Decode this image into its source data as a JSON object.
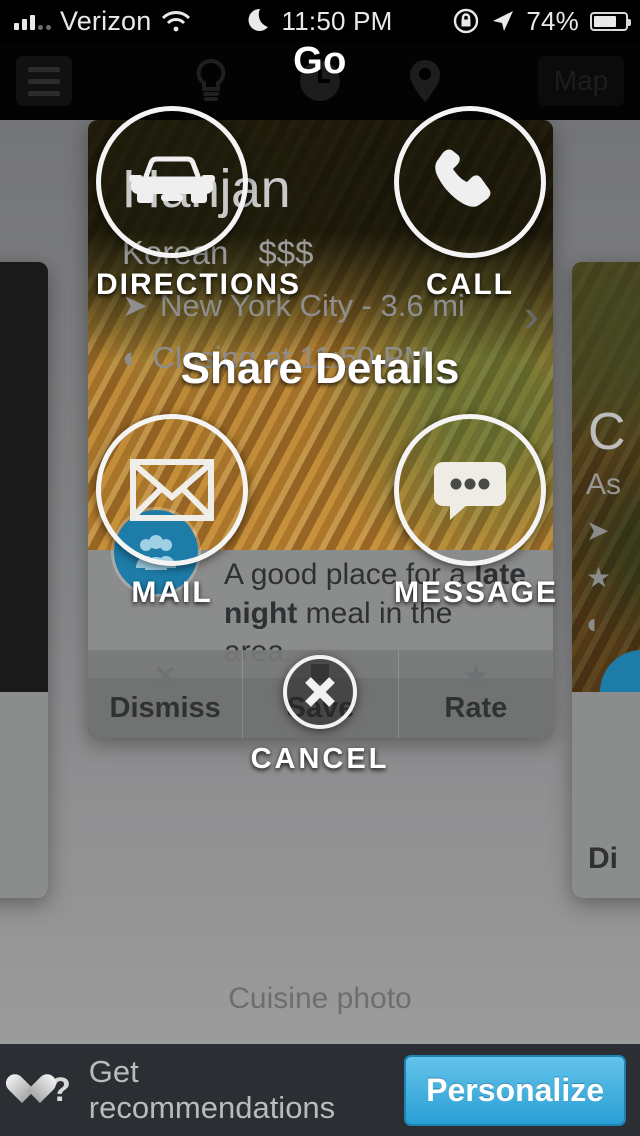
{
  "statusbar": {
    "carrier": "Verizon",
    "time": "11:50 PM",
    "battery_pct": "74%",
    "icons": [
      "signal-bars-icon",
      "wifi-icon",
      "moon-icon",
      "rotation-lock-icon",
      "location-arrow-icon",
      "battery-icon"
    ]
  },
  "navbar": {
    "title": "Go",
    "map_label": "Map",
    "icons": [
      "hamburger-menu-icon",
      "lightbulb-icon",
      "clock-icon",
      "map-pin-icon"
    ]
  },
  "card": {
    "name": "Hanjan",
    "cuisine": "Korean",
    "price": "$$$",
    "location": "New York City - 3.6 mi",
    "hours": "Closing at 11:50 PM",
    "description_prefix": "A good place for a ",
    "description_bold1": "late night",
    "description_suffix": " meal in the area.",
    "chevron": "›",
    "actions": [
      {
        "label": "Dismiss",
        "icon": "x-icon",
        "glyph": "✕"
      },
      {
        "label": "Save",
        "icon": "bookmark-icon",
        "glyph": ""
      },
      {
        "label": "Rate",
        "icon": "star-icon",
        "glyph": "★"
      }
    ]
  },
  "card_left": {
    "question": "?",
    "arrow": "›"
  },
  "card_right": {
    "title": "C",
    "subtitle": "As",
    "dismiss": "Di"
  },
  "caption": "Cuisine photo",
  "share_sheet": {
    "title": "Share Details",
    "buttons": [
      {
        "label": "DIRECTIONS",
        "icon": "car-icon"
      },
      {
        "label": "CALL",
        "icon": "phone-icon"
      },
      {
        "label": "MAIL",
        "icon": "envelope-icon"
      },
      {
        "label": "MESSAGE",
        "icon": "speech-bubble-icon"
      }
    ],
    "cancel_label": "CANCEL",
    "cancel_icon": "close-x-icon"
  },
  "bottombar": {
    "icon": "heart-question-icon",
    "text": "Get recommendations",
    "button_label": "Personalize",
    "button_color": "#2a9fd4"
  }
}
